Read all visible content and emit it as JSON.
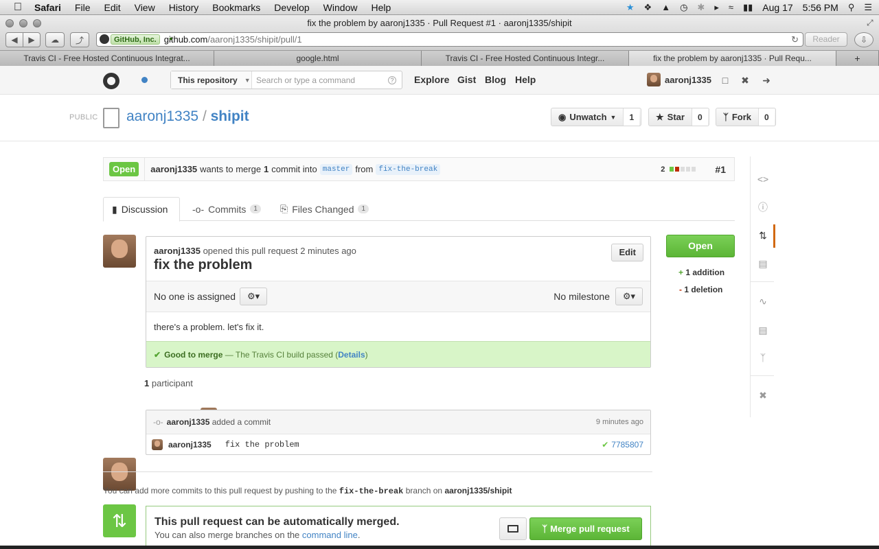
{
  "menubar": {
    "apple": "",
    "app": "Safari",
    "items": [
      "File",
      "Edit",
      "View",
      "History",
      "Bookmarks",
      "Develop",
      "Window",
      "Help"
    ],
    "date": "Aug 17",
    "time": "5:56 PM"
  },
  "window": {
    "title": "fix the problem by aaronj1335 · Pull Request #1 · aaronj1335/shipit"
  },
  "toolbar": {
    "cert_label": "GitHub, Inc.",
    "url_host": "github.com",
    "url_path": "/aaronj1335/shipit/pull/1",
    "reader_label": "Reader"
  },
  "tabs": [
    {
      "label": "Travis CI - Free Hosted Continuous Integrat..."
    },
    {
      "label": "google.html"
    },
    {
      "label": "Travis CI - Free Hosted Continuous Integr..."
    },
    {
      "label": "fix the problem by aaronj1335 · Pull Requ..."
    }
  ],
  "ghheader": {
    "scope": "This repository",
    "search_placeholder": "Search or type a command",
    "nav": [
      "Explore",
      "Gist",
      "Blog",
      "Help"
    ],
    "username": "aaronj1335"
  },
  "repo": {
    "visibility": "PUBLIC",
    "owner": "aaronj1335",
    "sep": "/",
    "name": "shipit",
    "unwatch_label": "Unwatch",
    "unwatch_count": "1",
    "star_label": "Star",
    "star_count": "0",
    "fork_label": "Fork",
    "fork_count": "0"
  },
  "pr": {
    "state": "Open",
    "author": "aaronj1335",
    "wants_text": "wants to merge",
    "commit_count": "1",
    "commit_word": "commit into",
    "base": "master",
    "from_word": "from",
    "head": "fix-the-break",
    "diff_total": "2",
    "number": "#1"
  },
  "prtabs": [
    {
      "label": "Discussion"
    },
    {
      "label": "Commits",
      "count": "1"
    },
    {
      "label": "Files Changed",
      "count": "1"
    }
  ],
  "discussion": {
    "author": "aaronj1335",
    "opened_text": "opened this pull request 2 minutes ago",
    "title": "fix the problem",
    "edit_label": "Edit",
    "assignee_text": "No one is assigned",
    "milestone_text": "No milestone",
    "body": "there's a problem. let's fix it.",
    "merge_status_bold": "Good to merge",
    "merge_status_text": "— The Travis CI build passed (",
    "merge_details": "Details",
    "merge_close": ")",
    "participants_count": "1",
    "participants_word": "participant"
  },
  "sidebar": {
    "open_label": "Open",
    "additions": "1 addition",
    "deletions": "1 deletion"
  },
  "commit_event": {
    "author": "aaronj1335",
    "action": "added a commit",
    "time": "9 minutes ago",
    "commit_author": "aaronj1335",
    "message": "fix the problem",
    "sha": "7785807"
  },
  "push_hint": {
    "prefix": "You can add more commits to this pull request by pushing to the",
    "branch": "fix-the-break",
    "middle": "branch on",
    "repo": "aaronj1335/shipit"
  },
  "merge_box": {
    "title": "This pull request can be automatically merged.",
    "subtitle_prefix": "You can also merge branches on the",
    "subtitle_link": "command line",
    "subtitle_suffix": ".",
    "merge_button": "Merge pull request"
  },
  "colors": {
    "open_green": "#6cc644",
    "link_blue": "#4183c4",
    "merge_bg": "#d8f5c8",
    "sidenav_active": "#d26911"
  }
}
